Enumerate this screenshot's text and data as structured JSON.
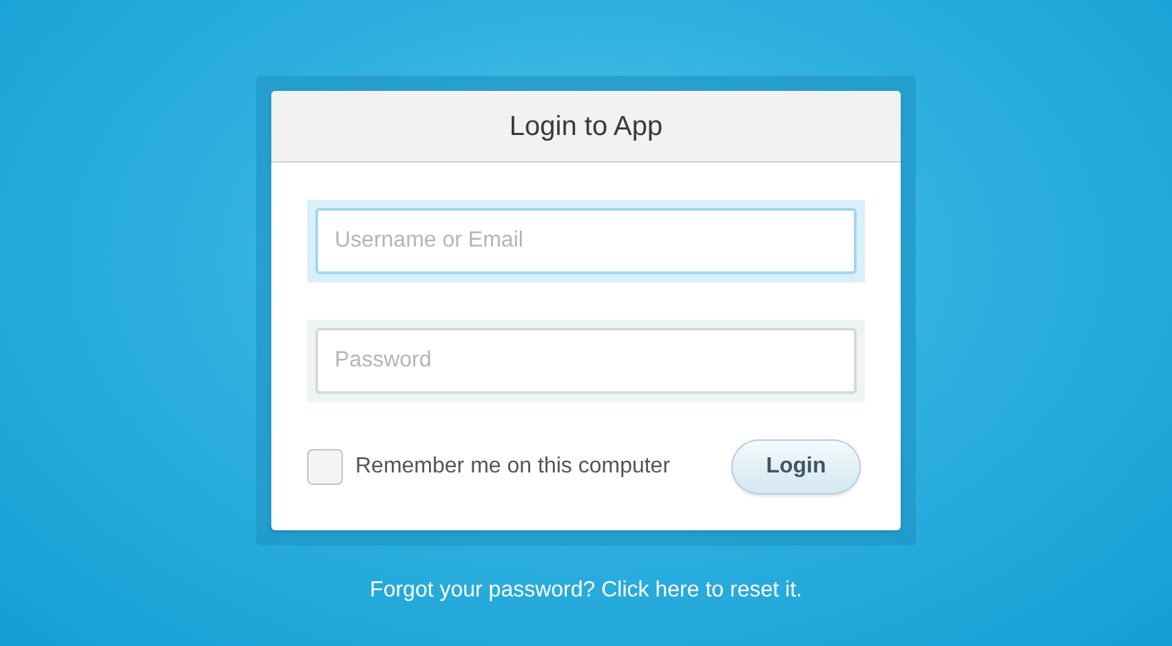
{
  "dialog": {
    "title": "Login to App"
  },
  "fields": [
    {
      "placeholder": "Username or Email",
      "focused": true
    },
    {
      "placeholder": "Password",
      "focused": false
    }
  ],
  "remember": {
    "label": "Remember me on this computer",
    "checked": false
  },
  "login_button": "Login",
  "footer_link": "Forgot your password? Click here to reset it."
}
